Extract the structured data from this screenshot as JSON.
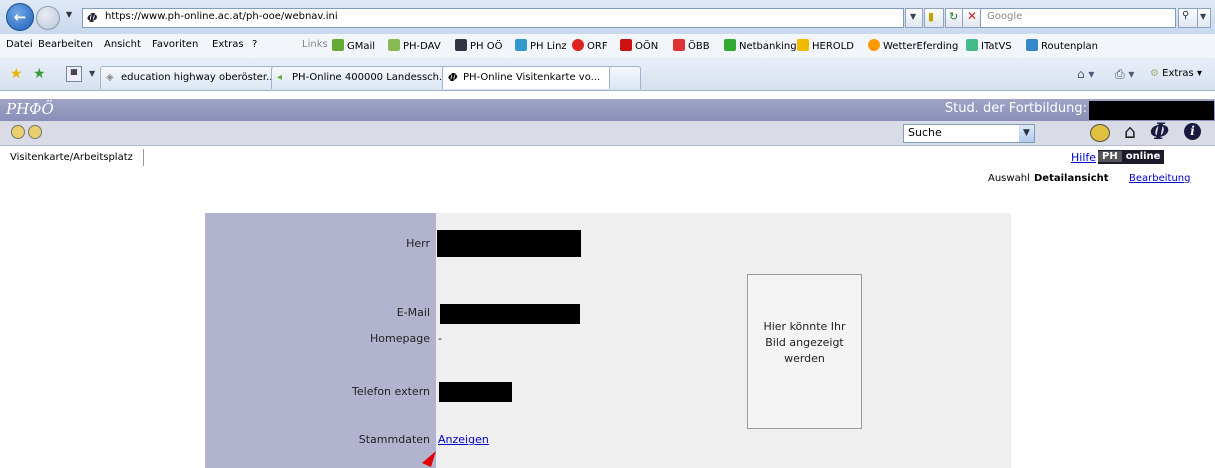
{
  "browser": {
    "url": "https://www.ph-online.ac.at/ph-ooe/webnav.ini",
    "search_placeholder": "Google",
    "menu": [
      "Datei",
      "Bearbeiten",
      "Ansicht",
      "Favoriten",
      "Extras",
      "?"
    ],
    "links_label": "Links",
    "links": [
      "GMail",
      "PH-DAV",
      "PH OÖ",
      "PH Linz",
      "ORF",
      "OÖN",
      "ÖBB",
      "Netbanking",
      "HEROLD",
      "WetterEferding",
      "ITatVS",
      "Routenplan"
    ],
    "tabs": [
      "education highway oberöster...",
      "PH-Online 400000 Landessch...",
      "PH-Online Visitenkarte vo..."
    ],
    "extras_label": "Extras"
  },
  "app": {
    "logo": "PHΦÖ",
    "user_label": "Stud. der Fortbildung:",
    "search_select": "Suche",
    "nav_tab": "Visitenkarte/Arbeitsplatz",
    "help_link": "Hilfe",
    "brand_ph": "PH",
    "brand_online": "online",
    "view_modes": {
      "auswahl": "Auswahl",
      "detail": "Detailansicht",
      "edit": "Bearbeitung"
    }
  },
  "card": {
    "salutation": "Herr",
    "email_label": "E-Mail",
    "homepage_label": "Homepage",
    "homepage_value": "-",
    "phone_label": "Telefon extern",
    "master_label": "Stammdaten",
    "master_link": "Anzeigen",
    "photo_text": "Hier könnte Ihr Bild angezeigt werden"
  },
  "colors": {
    "header": "#9ea3c6",
    "card_left": "#b2b4cf",
    "card_right": "#efefef",
    "link": "#0000cc"
  }
}
